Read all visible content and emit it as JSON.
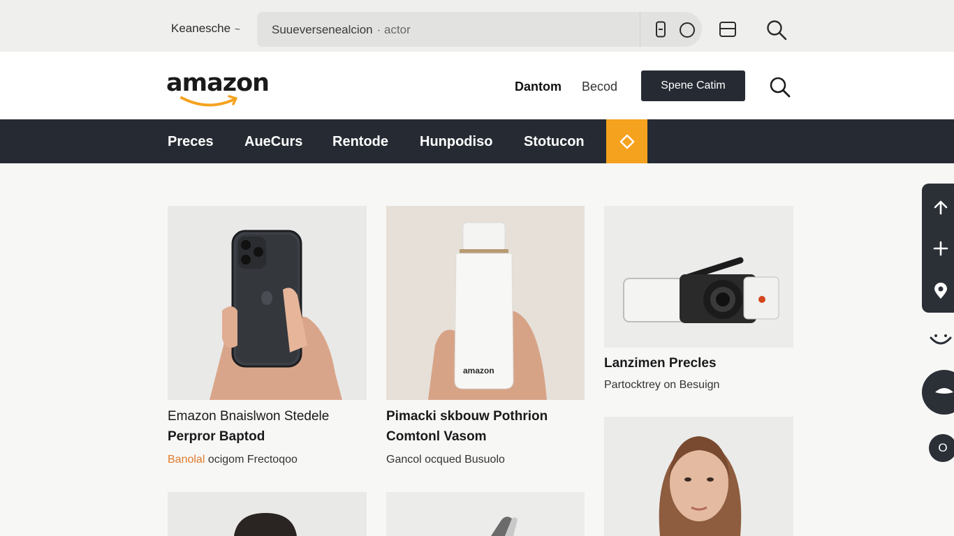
{
  "topbar": {
    "location_label": "Keanesche",
    "location_caret": "~",
    "search_text": "Suueversenealcion",
    "search_hint": "· actor"
  },
  "header": {
    "logo_text": "amazon",
    "link_1": "Dantom",
    "link_2": "Becod",
    "button_label": "Spene Catim"
  },
  "nav": {
    "items": [
      "Preces",
      "AueCurs",
      "Rentode",
      "Hunpodiso",
      "Stotucon"
    ]
  },
  "products": [
    {
      "line1": "Emazon Bnaislwon Stedele",
      "title": "Perpror Baptod",
      "sub_highlight": "Banolal",
      "sub_rest": " ocigom Frectoqoo"
    },
    {
      "product_label": "amazon",
      "title_line1": "Pimacki skbouw Pothrion",
      "title_line2": "Comtonl Vasom",
      "sub": "Gancol ocqued Busuolo"
    },
    {
      "title": "Lanzimen Precles",
      "sub": "Partocktrey on Besuign"
    }
  ],
  "floating": {
    "small_button_label": "O"
  },
  "colors": {
    "nav_bg": "#262b33",
    "accent": "#f5a21f",
    "highlight_text": "#e07a2a"
  }
}
